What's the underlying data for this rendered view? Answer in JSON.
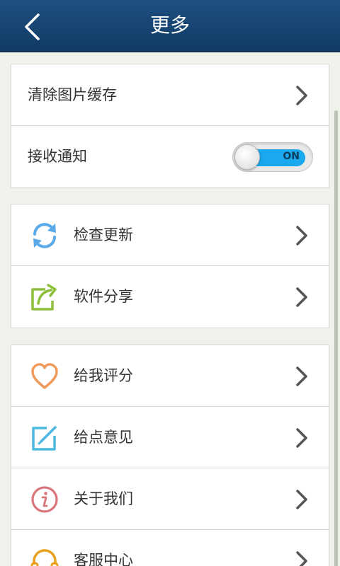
{
  "header": {
    "title": "更多"
  },
  "groups": [
    {
      "items": [
        {
          "label": "清除图片缓存"
        },
        {
          "label": "接收通知",
          "toggle_state": "ON"
        }
      ]
    },
    {
      "items": [
        {
          "label": "检查更新",
          "icon": "refresh-icon"
        },
        {
          "label": "软件分享",
          "icon": "share-icon"
        }
      ]
    },
    {
      "items": [
        {
          "label": "给我评分",
          "icon": "heart-icon"
        },
        {
          "label": "给点意见",
          "icon": "edit-icon"
        },
        {
          "label": "关于我们",
          "icon": "info-icon"
        },
        {
          "label": "客服中心",
          "icon": "headset-icon"
        }
      ]
    }
  ],
  "colors": {
    "header": "#1d4f80",
    "toggle_on": "#1aa9ee",
    "refresh_icon": "#5aa9e8",
    "share_icon": "#8dbf3a",
    "heart_icon": "#ef9a5a",
    "edit_icon": "#4ab8e0",
    "info_icon": "#d9747a",
    "headset_icon": "#e8a020"
  }
}
